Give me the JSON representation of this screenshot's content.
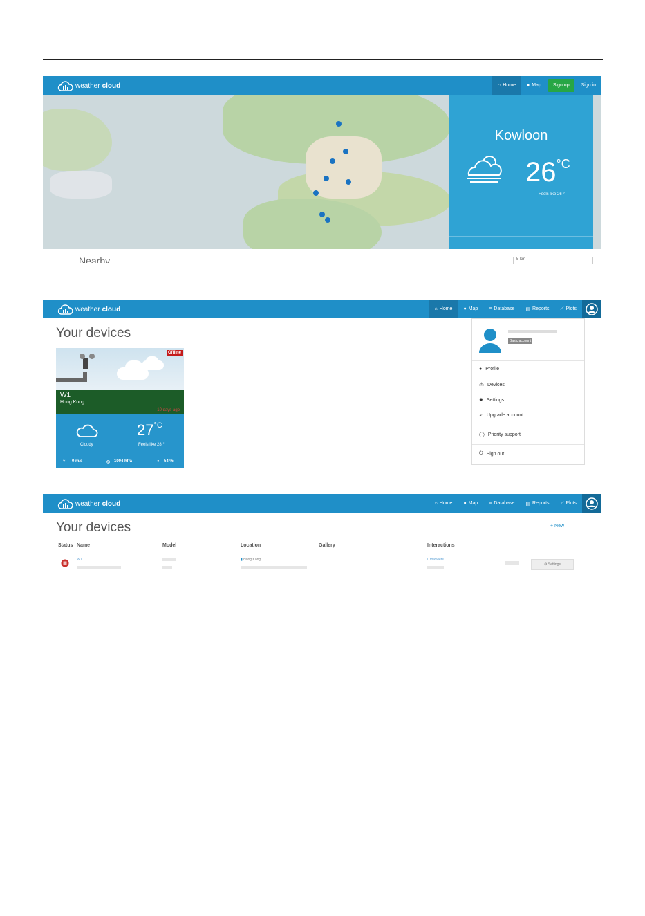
{
  "brand": {
    "prefix": "weather",
    "suffix": "cloud"
  },
  "shot1": {
    "nav": {
      "home": "Home",
      "map": "Map",
      "signup": "Sign up",
      "signin": "Sign in"
    },
    "weather": {
      "city": "Kowloon",
      "temp": "26",
      "unit": "°C",
      "condition": "",
      "feels": "Feels like 26 °",
      "wind": "",
      "pressure": "",
      "humidity": ""
    },
    "nearby": "Nearby",
    "select_value": "5 km"
  },
  "shot2": {
    "nav": {
      "home": "Home",
      "map": "Map",
      "database": "Database",
      "reports": "Reports",
      "plots": "Plots"
    },
    "title": "Your devices",
    "card": {
      "status": "Offline",
      "name": "W1",
      "place": "Hong Kong",
      "ago": "10 days ago",
      "temp": "27",
      "unit": "°C",
      "condition": "Cloudy",
      "feels": "Feels like 28 °",
      "wind": "0 m/s",
      "pressure": "1004 hPa",
      "humidity": "54 %"
    },
    "menu": {
      "badge": "Basic account",
      "items": [
        "Profile",
        "Devices",
        "Settings",
        "Upgrade account",
        "Priority support",
        "Sign out"
      ]
    }
  },
  "shot3": {
    "nav": {
      "home": "Home",
      "map": "Map",
      "database": "Database",
      "reports": "Reports",
      "plots": "Plots"
    },
    "title": "Your devices",
    "new_button": "New",
    "columns": [
      "Status",
      "Name",
      "Model",
      "Location",
      "Gallery",
      "Interactions"
    ],
    "row": {
      "name": "W1",
      "location": "Hong Kong",
      "interactions": "0 followers"
    },
    "settings_button": "Settings"
  },
  "colors": {
    "nav_blue": "#1f8fc8",
    "signup_green": "#27a645",
    "offline_red": "#c41b1b"
  }
}
